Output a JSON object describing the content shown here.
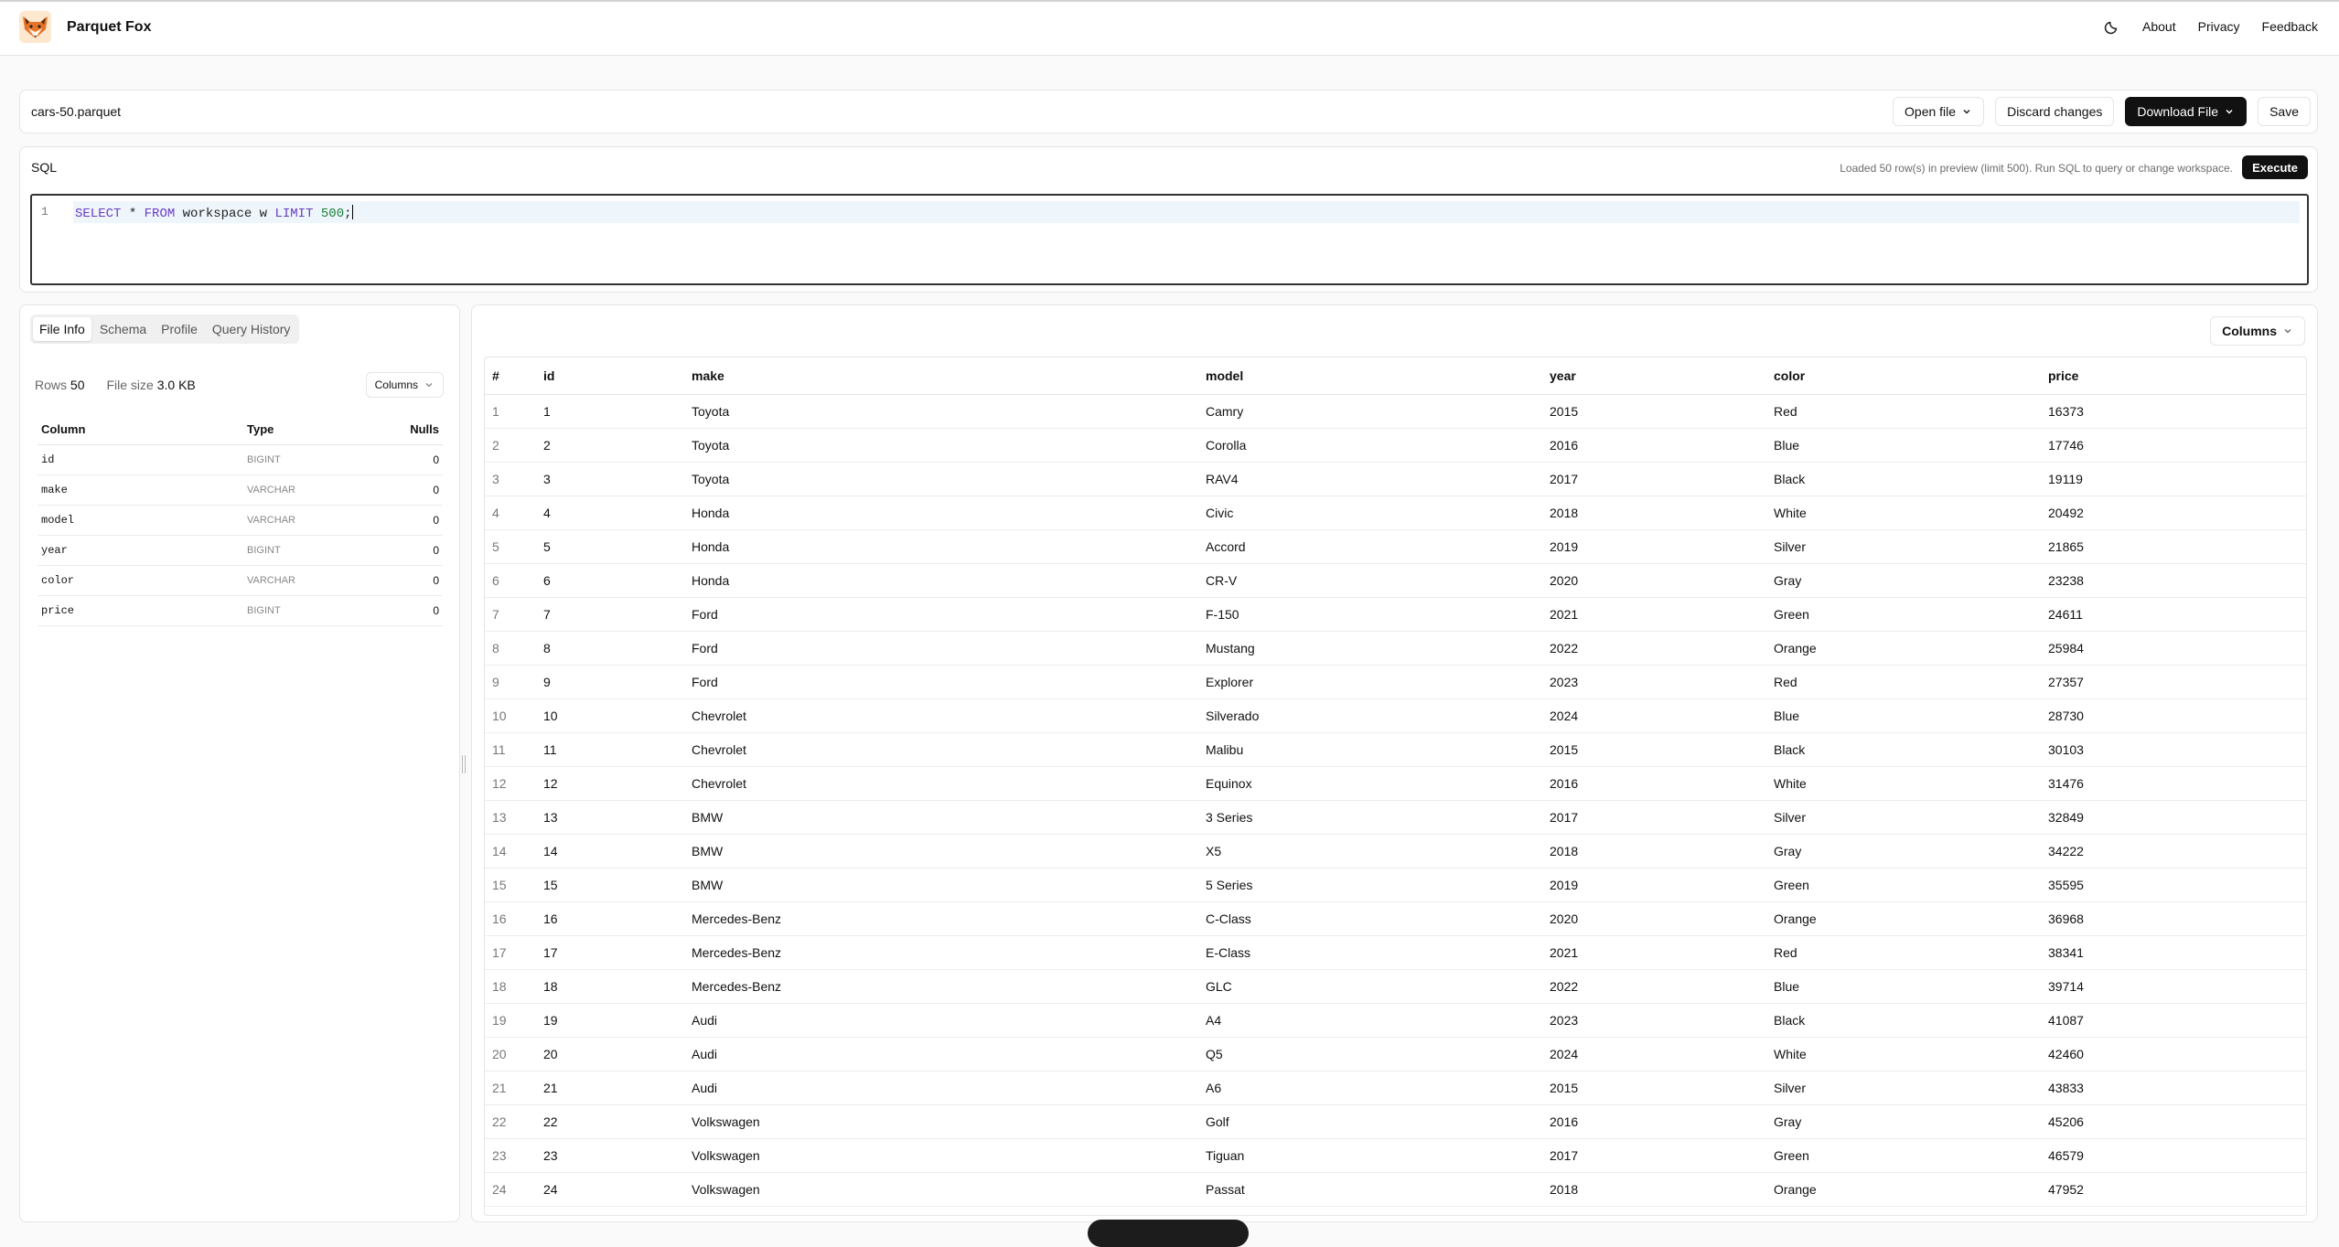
{
  "header": {
    "app_name": "Parquet Fox",
    "nav": [
      "About",
      "Privacy",
      "Feedback"
    ],
    "theme_icon": "moon-icon"
  },
  "file": {
    "name": "cars-50.parquet",
    "open_label": "Open file",
    "discard_label": "Discard changes",
    "download_label": "Download File",
    "save_label": "Save"
  },
  "sql": {
    "title": "SQL",
    "status": "Loaded 50 row(s) in preview (limit 500). Run SQL to query or change workspace.",
    "execute_label": "Execute",
    "line_number": "1",
    "tokens": {
      "select": "SELECT",
      "star": " * ",
      "from": "FROM",
      "ident": " workspace w ",
      "limit": "LIMIT",
      "space": " ",
      "number": "500",
      "semi": ";"
    }
  },
  "left": {
    "tabs": [
      "File Info",
      "Schema",
      "Profile",
      "Query History"
    ],
    "rows_label": "Rows",
    "rows_value": "50",
    "size_label": "File size",
    "size_value": "3.0 KB",
    "columns_btn": "Columns",
    "schema_headers": [
      "Column",
      "Type",
      "Nulls"
    ],
    "schema_rows": [
      {
        "name": "id",
        "type": "BIGINT",
        "nulls": "0"
      },
      {
        "name": "make",
        "type": "VARCHAR",
        "nulls": "0"
      },
      {
        "name": "model",
        "type": "VARCHAR",
        "nulls": "0"
      },
      {
        "name": "year",
        "type": "BIGINT",
        "nulls": "0"
      },
      {
        "name": "color",
        "type": "VARCHAR",
        "nulls": "0"
      },
      {
        "name": "price",
        "type": "BIGINT",
        "nulls": "0"
      }
    ]
  },
  "right": {
    "columns_btn": "Columns",
    "headers": [
      "#",
      "id",
      "make",
      "model",
      "year",
      "color",
      "price"
    ],
    "rows": [
      [
        "1",
        "1",
        "Toyota",
        "Camry",
        "2015",
        "Red",
        "16373"
      ],
      [
        "2",
        "2",
        "Toyota",
        "Corolla",
        "2016",
        "Blue",
        "17746"
      ],
      [
        "3",
        "3",
        "Toyota",
        "RAV4",
        "2017",
        "Black",
        "19119"
      ],
      [
        "4",
        "4",
        "Honda",
        "Civic",
        "2018",
        "White",
        "20492"
      ],
      [
        "5",
        "5",
        "Honda",
        "Accord",
        "2019",
        "Silver",
        "21865"
      ],
      [
        "6",
        "6",
        "Honda",
        "CR-V",
        "2020",
        "Gray",
        "23238"
      ],
      [
        "7",
        "7",
        "Ford",
        "F-150",
        "2021",
        "Green",
        "24611"
      ],
      [
        "8",
        "8",
        "Ford",
        "Mustang",
        "2022",
        "Orange",
        "25984"
      ],
      [
        "9",
        "9",
        "Ford",
        "Explorer",
        "2023",
        "Red",
        "27357"
      ],
      [
        "10",
        "10",
        "Chevrolet",
        "Silverado",
        "2024",
        "Blue",
        "28730"
      ],
      [
        "11",
        "11",
        "Chevrolet",
        "Malibu",
        "2015",
        "Black",
        "30103"
      ],
      [
        "12",
        "12",
        "Chevrolet",
        "Equinox",
        "2016",
        "White",
        "31476"
      ],
      [
        "13",
        "13",
        "BMW",
        "3 Series",
        "2017",
        "Silver",
        "32849"
      ],
      [
        "14",
        "14",
        "BMW",
        "X5",
        "2018",
        "Gray",
        "34222"
      ],
      [
        "15",
        "15",
        "BMW",
        "5 Series",
        "2019",
        "Green",
        "35595"
      ],
      [
        "16",
        "16",
        "Mercedes-Benz",
        "C-Class",
        "2020",
        "Orange",
        "36968"
      ],
      [
        "17",
        "17",
        "Mercedes-Benz",
        "E-Class",
        "2021",
        "Red",
        "38341"
      ],
      [
        "18",
        "18",
        "Mercedes-Benz",
        "GLC",
        "2022",
        "Blue",
        "39714"
      ],
      [
        "19",
        "19",
        "Audi",
        "A4",
        "2023",
        "Black",
        "41087"
      ],
      [
        "20",
        "20",
        "Audi",
        "Q5",
        "2024",
        "White",
        "42460"
      ],
      [
        "21",
        "21",
        "Audi",
        "A6",
        "2015",
        "Silver",
        "43833"
      ],
      [
        "22",
        "22",
        "Volkswagen",
        "Golf",
        "2016",
        "Gray",
        "45206"
      ],
      [
        "23",
        "23",
        "Volkswagen",
        "Tiguan",
        "2017",
        "Green",
        "46579"
      ],
      [
        "24",
        "24",
        "Volkswagen",
        "Passat",
        "2018",
        "Orange",
        "47952"
      ]
    ]
  }
}
